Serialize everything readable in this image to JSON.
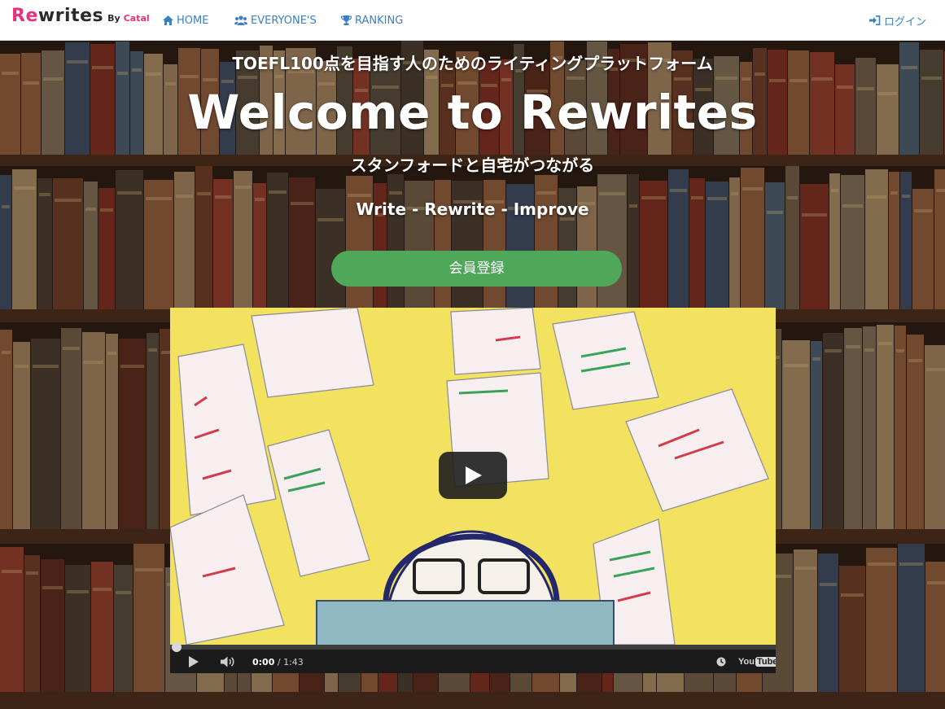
{
  "brand": {
    "re": "Re",
    "rest": "writes",
    "by": "By",
    "catal": "Catal",
    "brand_color": "#e6327d"
  },
  "nav": {
    "home": {
      "label": "HOME",
      "icon": "home-icon"
    },
    "everyone": {
      "label": "EVERYONE'S",
      "icon": "users-icon"
    },
    "ranking": {
      "label": "RANKING",
      "icon": "trophy-icon"
    },
    "login": {
      "label": "ログイン",
      "icon": "sign-in-icon"
    },
    "link_color": "#3a7fc1"
  },
  "hero": {
    "tagline": "TOEFL100点を目指す人のためのライティングプラットフォーム",
    "title": "Welcome to Rewrites",
    "subtitle": "スタンフォードと自宅がつながる",
    "motto": "Write - Rewrite - Improve",
    "signup_label": "会員登録",
    "signup_color": "#4fa75a"
  },
  "video": {
    "current_time": "0:00",
    "separator": " / ",
    "duration": "1:43",
    "logo_you": "You",
    "logo_tube": "Tube"
  }
}
